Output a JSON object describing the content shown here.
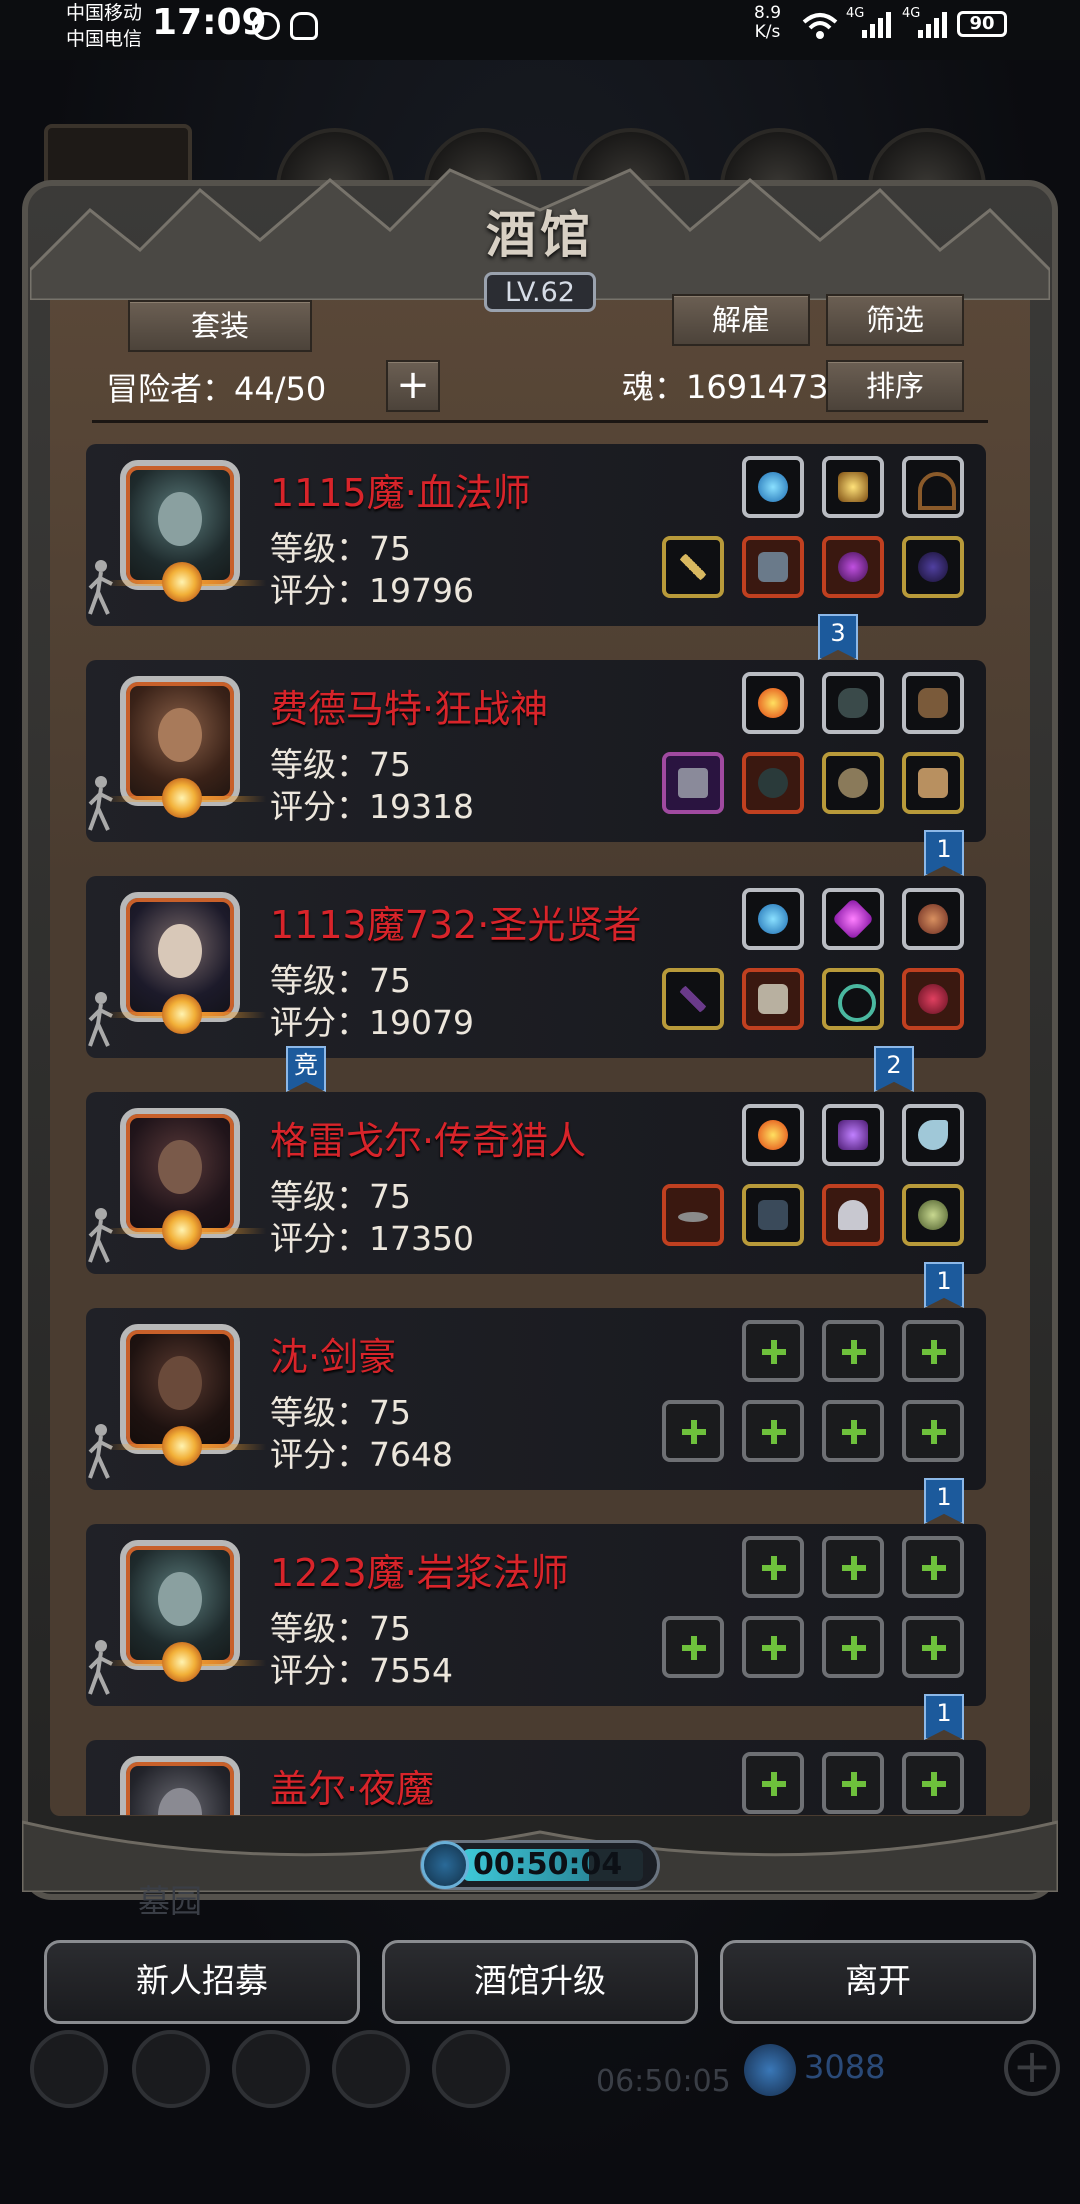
{
  "status_bar": {
    "carrier1": "中国移动",
    "carrier2": "中国电信",
    "time": "17:09",
    "speed_value": "8.9",
    "speed_unit": "K/s",
    "network1": "4G",
    "network2": "4G",
    "battery": "90"
  },
  "panel": {
    "title": "酒馆",
    "level": "LV.62",
    "outfit_button": "套装",
    "dismiss_button": "解雇",
    "filter_button": "筛选",
    "sort_button": "排序",
    "adventurer_label": "冒险者：44/50",
    "soul_label": "魂：1691473"
  },
  "heroes": [
    {
      "name": "1115魔·血法师",
      "level": "等级：75",
      "score": "评分：19796",
      "flag": "3"
    },
    {
      "name": "费德马特·狂战神",
      "level": "等级：75",
      "score": "评分：19318",
      "flag": "1"
    },
    {
      "name": "1113魔732·圣光贤者",
      "level": "等级：75",
      "score": "评分：19079",
      "flag": "2",
      "left_flag": "竞"
    },
    {
      "name": "格雷戈尔·传奇猎人",
      "level": "等级：75",
      "score": "评分：17350",
      "flag": "1"
    },
    {
      "name": "沈·剑豪",
      "level": "等级：75",
      "score": "评分：7648",
      "flag": "1"
    },
    {
      "name": "1223魔·岩浆法师",
      "level": "等级：75",
      "score": "评分：7554",
      "flag": "1"
    },
    {
      "name": "盖尔·夜魔",
      "level": "",
      "score": ""
    }
  ],
  "timer": "00:50:04",
  "faded_label": "墓园",
  "bottom_buttons": {
    "recruit": "新人招募",
    "upgrade": "酒馆升级",
    "leave": "离开"
  },
  "background": {
    "timer2": "06:50:05",
    "gems": "3088"
  }
}
